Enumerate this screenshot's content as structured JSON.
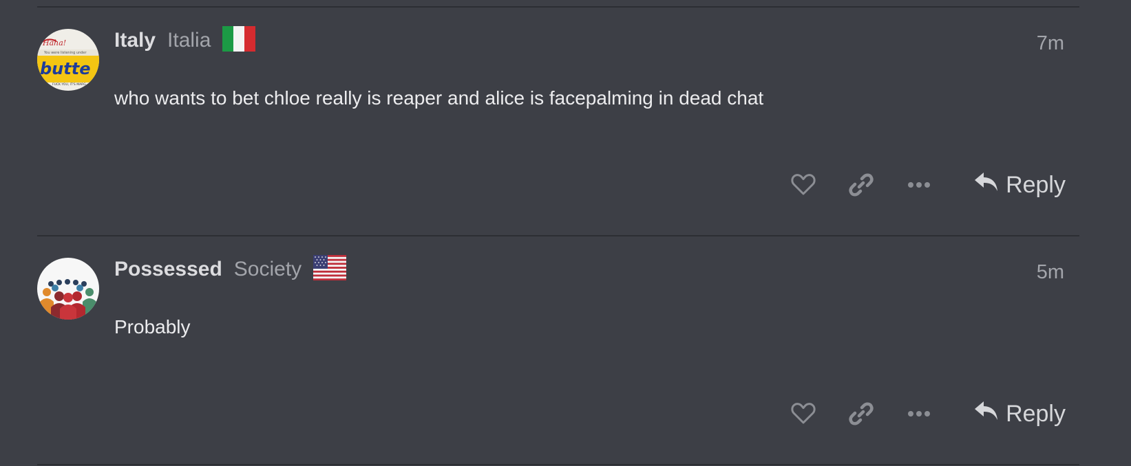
{
  "posts": [
    {
      "username": "Italy",
      "user_title": "Italia",
      "flag": "italy-flag",
      "age": "7m",
      "body": "who wants to bet chloe really is reaper and alice is facepalming in dead chat",
      "avatar_text": "butte",
      "reply_label": "Reply"
    },
    {
      "username": "Possessed",
      "user_title": "Society",
      "flag": "usa-flag",
      "age": "5m",
      "body": "Probably",
      "avatar_text": "",
      "reply_label": "Reply"
    }
  ],
  "icons": {
    "like": "heart-icon",
    "share": "link-icon",
    "more": "ellipsis-icon",
    "reply": "reply-arrow-icon"
  },
  "colors": {
    "background": "#3d3f46",
    "divider": "#2c2e33",
    "muted_text": "#a3a5ab",
    "icon": "#8c8e94"
  }
}
